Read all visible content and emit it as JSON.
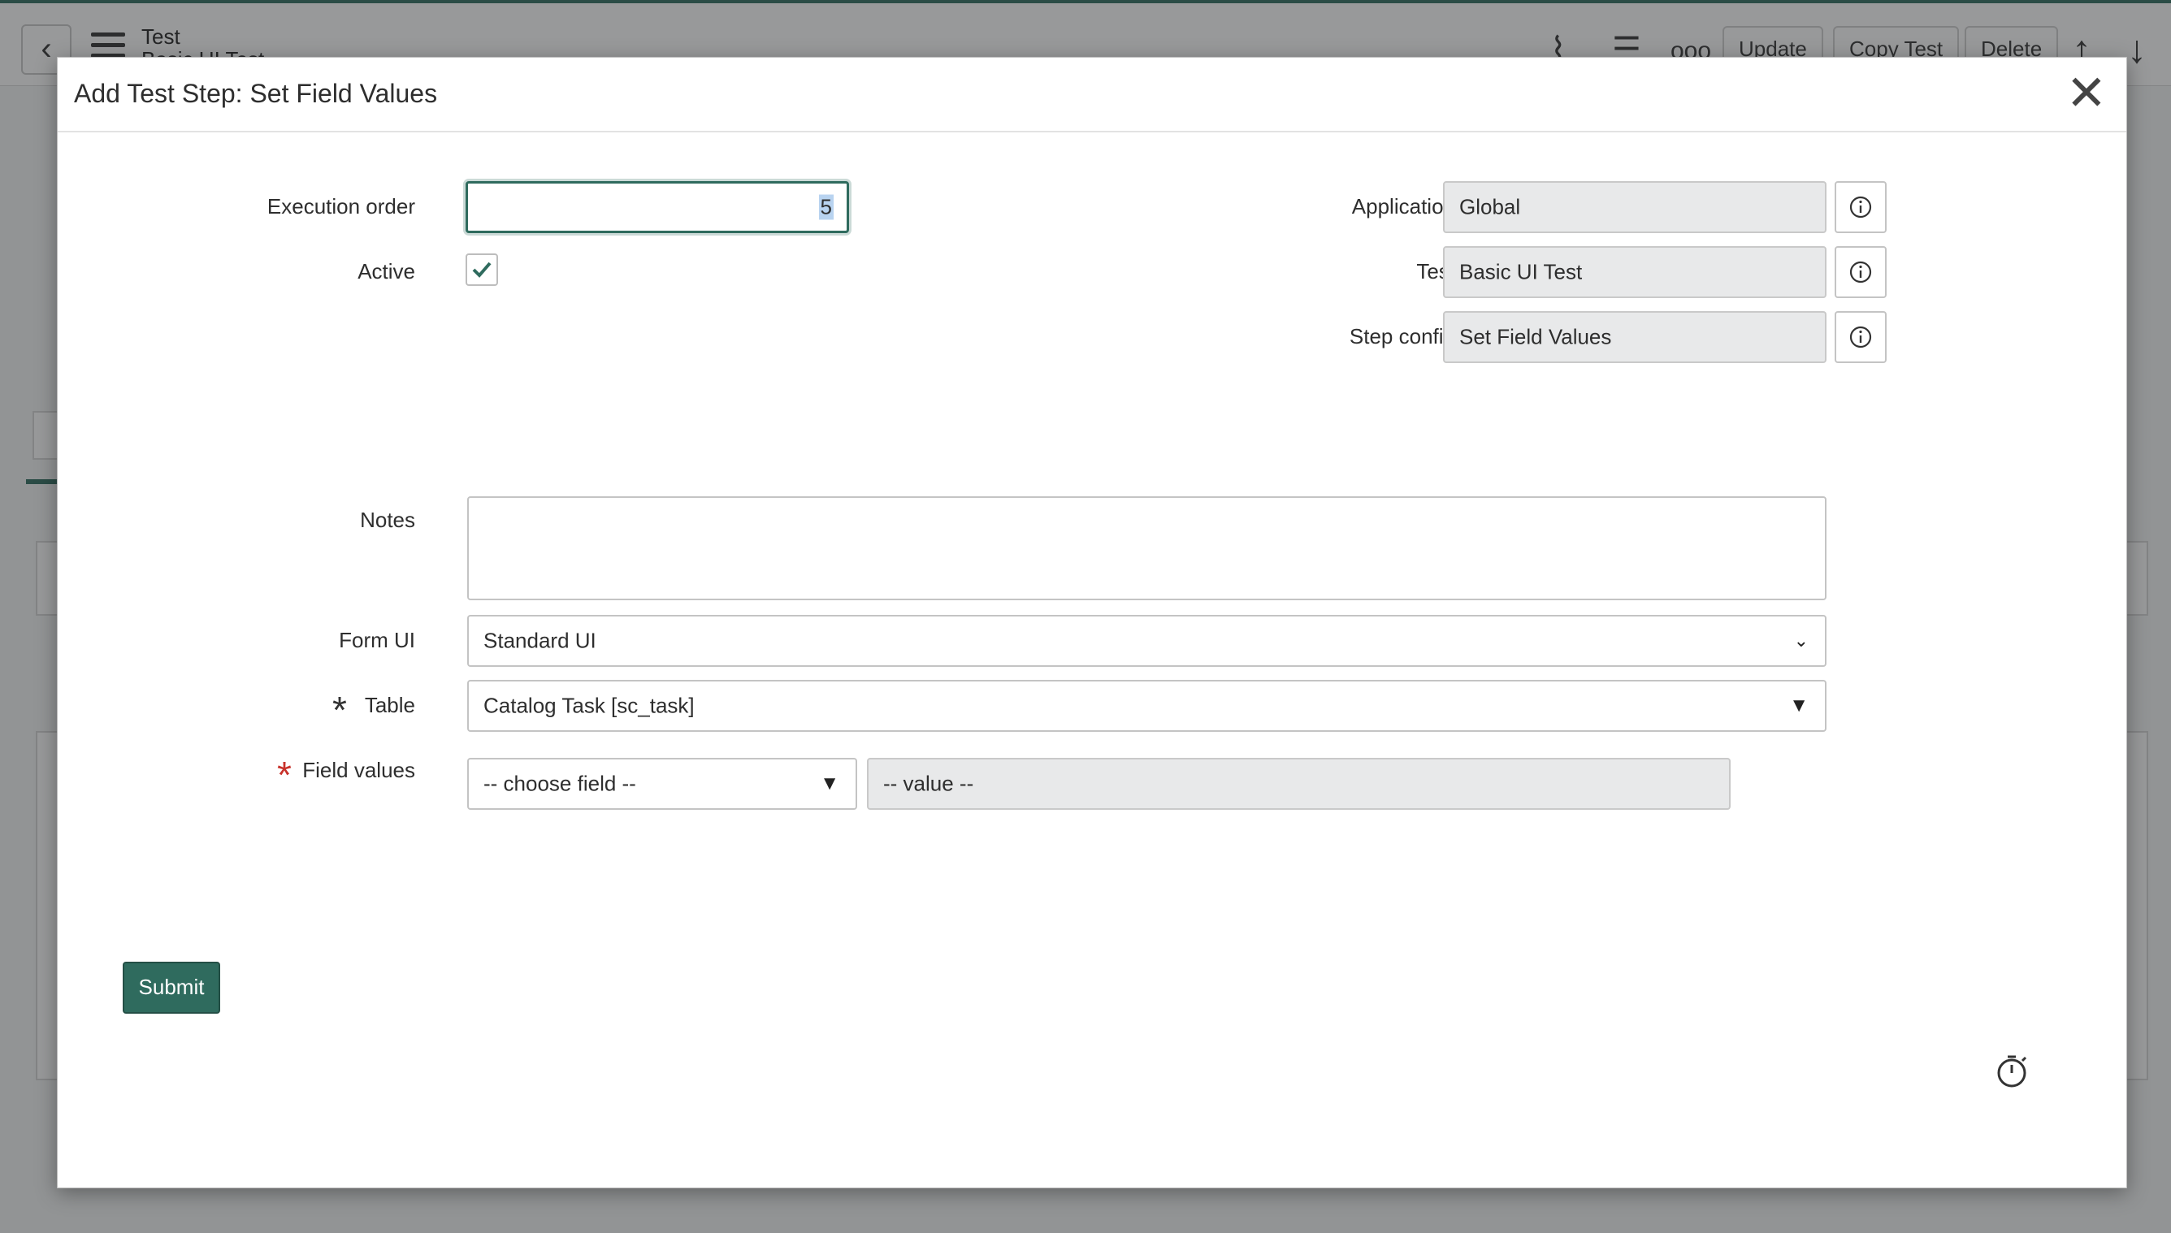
{
  "background": {
    "title": "Test",
    "subtitle": "Basic UI Test",
    "buttons": {
      "update": "Update",
      "copy_test": "Copy Test",
      "delete": "Delete"
    },
    "icons": [
      "back-icon",
      "menu-icon",
      "paperclip-icon",
      "sliders-icon",
      "more-icon",
      "arrow-up-icon",
      "arrow-down-icon"
    ]
  },
  "modal": {
    "title": "Add Test Step: Set Field Values",
    "close_icon": "close-icon",
    "fields": {
      "execution_order": {
        "label": "Execution order",
        "value": "5"
      },
      "active": {
        "label": "Active",
        "checked": true
      },
      "application": {
        "label": "Application",
        "value": "Global"
      },
      "test": {
        "label": "Test",
        "value": "Basic UI Test"
      },
      "step_config": {
        "label": "Step config",
        "value": "Set Field Values"
      },
      "notes": {
        "label": "Notes",
        "value": ""
      },
      "form_ui": {
        "label": "Form UI",
        "value": "Standard UI"
      },
      "table": {
        "label": "Table",
        "value": "Catalog Task [sc_task]",
        "required": true
      },
      "field_values": {
        "label": "Field values",
        "choose_placeholder": "-- choose field --",
        "value_placeholder": "-- value --",
        "required": true
      }
    },
    "submit_label": "Submit"
  },
  "colors": {
    "accent": "#2f6b5e",
    "required_red": "#c8322b",
    "readonly_bg": "#e8e9ea"
  }
}
